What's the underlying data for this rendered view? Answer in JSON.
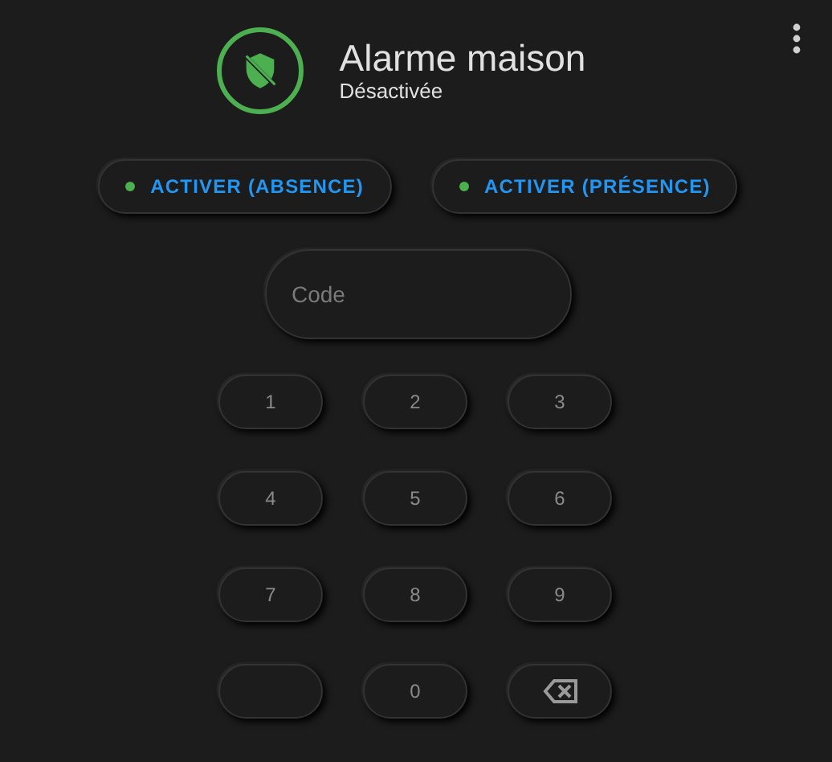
{
  "header": {
    "title": "Alarme maison",
    "state": "Désactivée"
  },
  "actions": [
    {
      "label": "ACTIVER (ABSENCE)"
    },
    {
      "label": "ACTIVER (PRÉSENCE)"
    }
  ],
  "code_field": {
    "placeholder": "Code"
  },
  "keypad": [
    {
      "kind": "digit",
      "label": "1"
    },
    {
      "kind": "digit",
      "label": "2"
    },
    {
      "kind": "digit",
      "label": "3"
    },
    {
      "kind": "digit",
      "label": "4"
    },
    {
      "kind": "digit",
      "label": "5"
    },
    {
      "kind": "digit",
      "label": "6"
    },
    {
      "kind": "digit",
      "label": "7"
    },
    {
      "kind": "digit",
      "label": "8"
    },
    {
      "kind": "digit",
      "label": "9"
    },
    {
      "kind": "blank"
    },
    {
      "kind": "digit",
      "label": "0"
    },
    {
      "kind": "backspace"
    }
  ]
}
